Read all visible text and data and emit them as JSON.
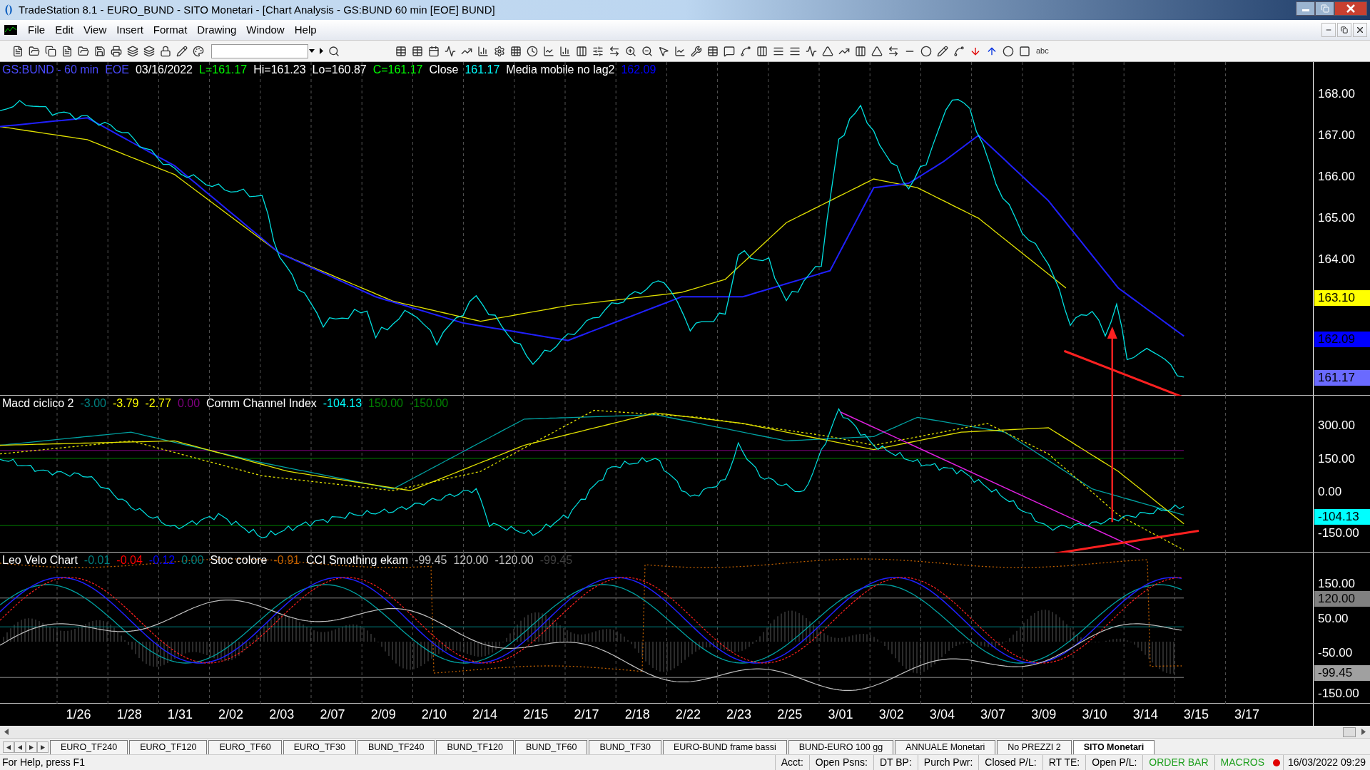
{
  "window": {
    "title": "TradeStation 8.1 - EURO_BUND - SITO Monetari - [Chart Analysis - GS:BUND  60 min  [EOE] BUND]"
  },
  "toolbar": {
    "text_tool": "abc"
  },
  "menu": [
    "File",
    "Edit",
    "View",
    "Insert",
    "Format",
    "Drawing",
    "Window",
    "Help"
  ],
  "panels": [
    {
      "legend": [
        {
          "text": "GS:BUND - 60 min",
          "color": "#4a4aff"
        },
        {
          "text": "EOE",
          "color": "#4a4aff"
        },
        {
          "text": "03/16/2022",
          "color": "#ffffff"
        },
        {
          "text": "L=161.17",
          "color": "#00ff00"
        },
        {
          "text": "Hi=161.23",
          "color": "#ffffff"
        },
        {
          "text": "Lo=160.87",
          "color": "#ffffff"
        },
        {
          "text": "C=161.17",
          "color": "#00ff00"
        },
        {
          "text": "Close",
          "color": "#ffffff"
        },
        {
          "text": "161.17",
          "color": "#00ffff"
        },
        {
          "text": "Media mobile no lag2",
          "color": "#ffffff"
        },
        {
          "text": "162.09",
          "color": "#0000ff"
        }
      ],
      "ticks": [
        "168.00",
        "167.00",
        "166.00",
        "165.00",
        "164.00"
      ],
      "markers": [
        {
          "text": "163.10",
          "color": "#ffff00"
        },
        {
          "text": "162.09",
          "color": "#0000ff"
        },
        {
          "text": "161.17",
          "color": "#6a6aff"
        }
      ]
    },
    {
      "legend": [
        {
          "text": "Macd ciclico 2",
          "color": "#ffffff"
        },
        {
          "text": "-3.00",
          "color": "#008080"
        },
        {
          "text": "-3.79",
          "color": "#ffff00"
        },
        {
          "text": "-2.77",
          "color": "#ffff00"
        },
        {
          "text": "0.00",
          "color": "#800080"
        },
        {
          "text": "Comm Channel Index",
          "color": "#ffffff"
        },
        {
          "text": "-104.13",
          "color": "#00ffff"
        },
        {
          "text": "150.00",
          "color": "#008000"
        },
        {
          "text": "-150.00",
          "color": "#008000"
        }
      ],
      "ticks": [
        "300.00",
        "150.00",
        "0.00",
        "-150.00"
      ],
      "markers": [
        {
          "text": "-104.13",
          "color": "#00ffff"
        }
      ]
    },
    {
      "legend": [
        {
          "text": "Leo Velo Chart",
          "color": "#ffffff"
        },
        {
          "text": "-0.01",
          "color": "#008080"
        },
        {
          "text": "-0.04",
          "color": "#ff0000"
        },
        {
          "text": "-0.12",
          "color": "#0000ff"
        },
        {
          "text": "0.00",
          "color": "#008080"
        },
        {
          "text": "Stoc colore",
          "color": "#ffffff"
        },
        {
          "text": "-0.91",
          "color": "#c06000"
        },
        {
          "text": "CCI Smothing ekam",
          "color": "#ffffff"
        },
        {
          "text": "-99.45",
          "color": "#c0c0c0"
        },
        {
          "text": "120.00",
          "color": "#c0c0c0"
        },
        {
          "text": "-120.00",
          "color": "#c0c0c0"
        },
        {
          "text": "-99.45",
          "color": "#404040"
        }
      ],
      "ticks": [
        "150.00",
        "50.00",
        "-50.00",
        "-150.00"
      ],
      "markers": [
        {
          "text": "120.00",
          "color": "#808080"
        },
        {
          "text": "-99.45",
          "color": "#a0a0a0"
        }
      ]
    }
  ],
  "x_axis": [
    "1/26",
    "1/28",
    "1/31",
    "2/02",
    "2/03",
    "2/07",
    "2/09",
    "2/10",
    "2/14",
    "2/15",
    "2/17",
    "2/18",
    "2/22",
    "2/23",
    "2/25",
    "3/01",
    "3/02",
    "3/04",
    "3/07",
    "3/09",
    "3/10",
    "3/14",
    "3/15",
    "3/17"
  ],
  "tabs": [
    {
      "label": "EURO_TF240",
      "selected": false
    },
    {
      "label": "EURO_TF120",
      "selected": false
    },
    {
      "label": "EURO_TF60",
      "selected": false
    },
    {
      "label": "EURO_TF30",
      "selected": false
    },
    {
      "label": "BUND_TF240",
      "selected": false
    },
    {
      "label": "BUND_TF120",
      "selected": false
    },
    {
      "label": "BUND_TF60",
      "selected": false
    },
    {
      "label": "BUND_TF30",
      "selected": false
    },
    {
      "label": "EURO-BUND frame bassi",
      "selected": false
    },
    {
      "label": "BUND-EURO 100 gg",
      "selected": false
    },
    {
      "label": "ANNUALE Monetari",
      "selected": false
    },
    {
      "label": "No PREZZI 2",
      "selected": false
    },
    {
      "label": "SITO Monetari",
      "selected": true
    }
  ],
  "status_bar": {
    "help": "For Help, press F1",
    "fields": [
      {
        "text": "Acct:",
        "kind": "label"
      },
      {
        "text": "Open Psns:",
        "kind": "label"
      },
      {
        "text": "DT BP:",
        "kind": "label"
      },
      {
        "text": "Purch Pwr:",
        "kind": "label"
      },
      {
        "text": "Closed P/L:",
        "kind": "label"
      },
      {
        "text": "RT TE:",
        "kind": "label"
      },
      {
        "text": "Open P/L:",
        "kind": "label"
      },
      {
        "text": "ORDER BAR",
        "kind": "toggle"
      },
      {
        "text": "MACROS",
        "kind": "toggle"
      }
    ],
    "datetime": "16/03/2022 09:29"
  }
}
